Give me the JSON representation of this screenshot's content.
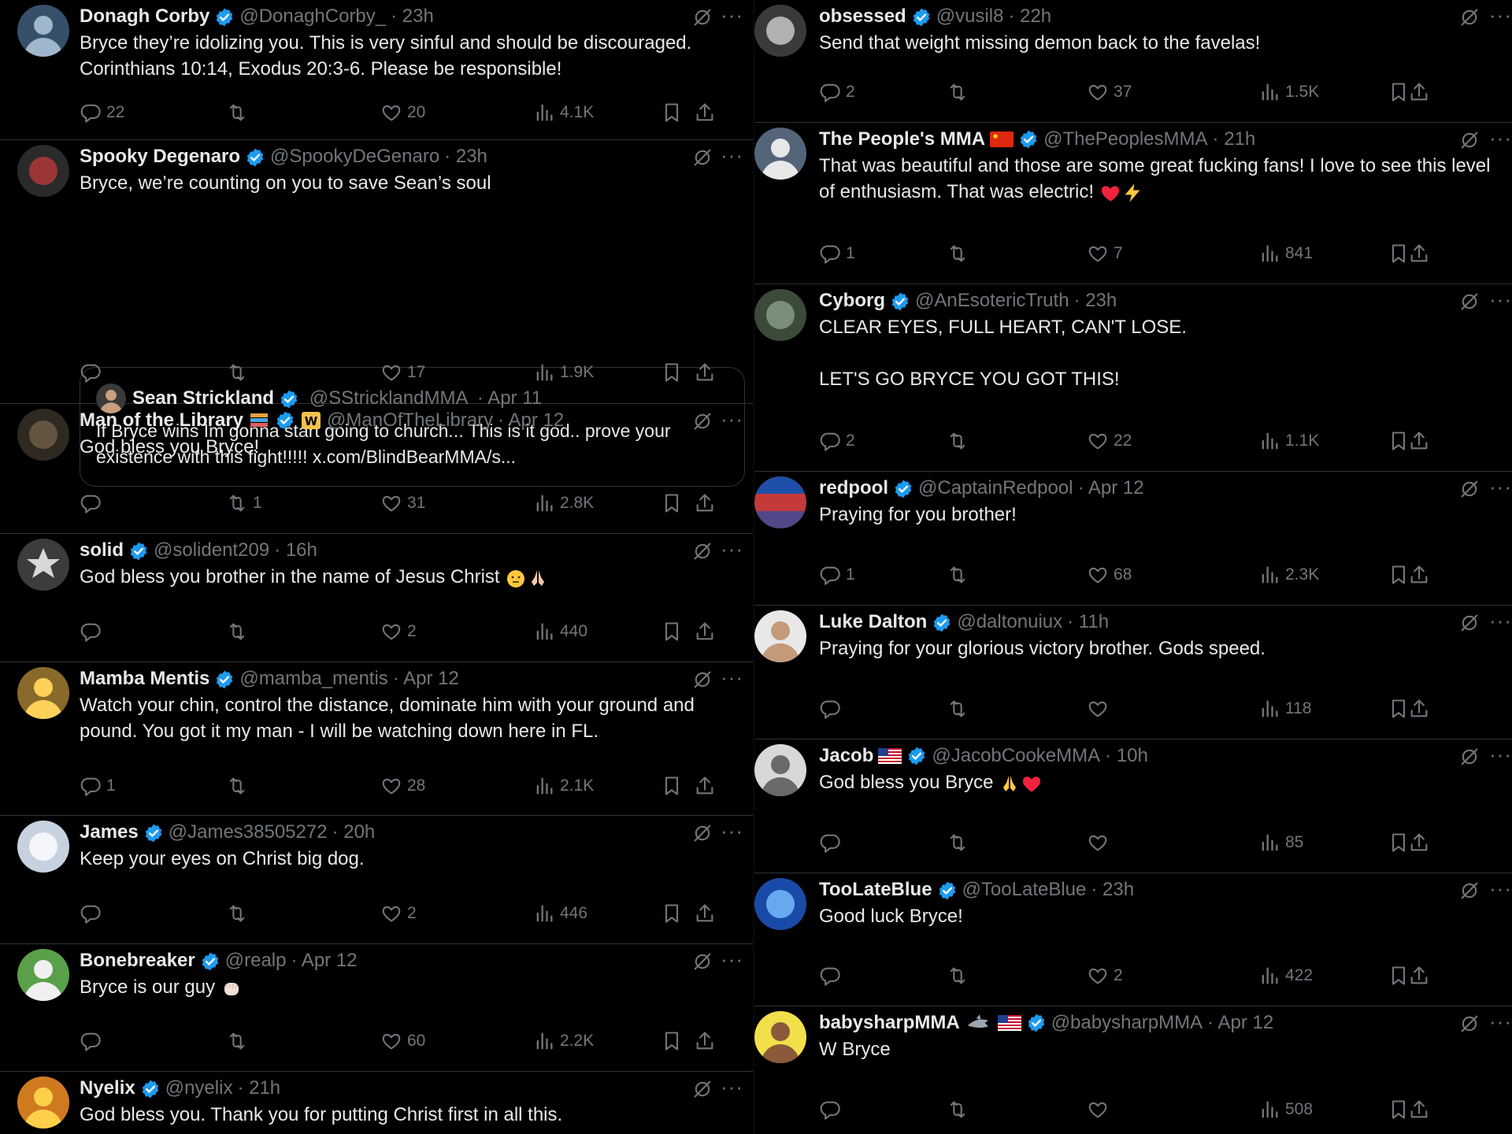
{
  "left_column": [
    {
      "name": "Donagh Corby",
      "handle": "@DonaghCorby_",
      "time": "· 23h",
      "text": "Bryce they’re idolizing you. This is very sinful and should be discouraged. Corinthians 10:14, Exodus 20:3-6. Please be responsible!",
      "replies": "22",
      "retweets": "",
      "likes": "20",
      "views": "4.1K"
    },
    {
      "name": "Spooky Degenaro",
      "handle": "@SpookyDeGenaro",
      "time": "· 23h",
      "text": "Bryce, we’re counting on you to save Sean’s soul",
      "replies": "",
      "retweets": "",
      "likes": "17",
      "views": "1.9K",
      "quote": {
        "name": "Sean Strickland",
        "handle": "@SStricklandMMA",
        "time": "· Apr 11",
        "text": "If Bryce wins Im gonna start going to church... This is it god.. prove your existence with this fight!!!!! x.com/BlindBearMMA/s..."
      }
    },
    {
      "name": "Man of the Library",
      "handle": "@ManOfTheLibrary",
      "time": "· Apr 12",
      "text": "God bless you Bryce!",
      "replies": "",
      "retweets": "1",
      "likes": "31",
      "views": "2.8K"
    },
    {
      "name": "solid",
      "handle": "@solident209",
      "time": "· 16h",
      "text": "God bless you brother in the name of Jesus Christ",
      "replies": "",
      "retweets": "",
      "likes": "2",
      "views": "440"
    },
    {
      "name": "Mamba Mentis",
      "handle": "@mamba_mentis",
      "time": "· Apr 12",
      "text": "Watch your chin, control the distance, dominate him with your ground and pound.  You got it my man - I will be watching down here in FL.",
      "replies": "1",
      "retweets": "",
      "likes": "28",
      "views": "2.1K"
    },
    {
      "name": "James",
      "handle": "@James38505272",
      "time": "· 20h",
      "text": "Keep your eyes on Christ big dog.",
      "replies": "",
      "retweets": "",
      "likes": "2",
      "views": "446"
    },
    {
      "name": "Bonebreaker",
      "handle": "@realp",
      "time": "· Apr 12",
      "text": "Bryce is our guy",
      "replies": "",
      "retweets": "",
      "likes": "60",
      "views": "2.2K"
    },
    {
      "name": "Nyelix",
      "handle": "@nyelix",
      "time": "· 21h",
      "text": "God bless you.  Thank you for putting Christ first in all this.",
      "replies": "",
      "retweets": "",
      "likes": "",
      "views": ""
    }
  ],
  "right_column": [
    {
      "name": "obsessed",
      "handle": "@vusil8",
      "time": "· 22h",
      "text": "Send that weight missing demon back to the favelas!",
      "replies": "2",
      "retweets": "",
      "likes": "37",
      "views": "1.5K"
    },
    {
      "name": "The People's MMA",
      "handle": "@ThePeoplesMMA",
      "time": "· 21h",
      "text": "That was beautiful and those are some great fucking fans! I love to see this level of enthusiasm. That was electric!",
      "replies": "1",
      "retweets": "",
      "likes": "7",
      "views": "841"
    },
    {
      "name": "Cyborg",
      "handle": "@AnEsotericTruth",
      "time": "· 23h",
      "text": "CLEAR EYES, FULL HEART, CAN'T LOSE.",
      "text2": "LET'S GO BRYCE YOU GOT THIS!",
      "replies": "2",
      "retweets": "",
      "likes": "22",
      "views": "1.1K"
    },
    {
      "name": "redpool",
      "handle": "@CaptainRedpool",
      "time": "· Apr 12",
      "text": "Praying for you brother!",
      "replies": "1",
      "retweets": "",
      "likes": "68",
      "views": "2.3K"
    },
    {
      "name": "Luke Dalton",
      "handle": "@daltonuiux",
      "time": "· 11h",
      "text": "Praying for your glorious victory brother. Gods speed.",
      "replies": "",
      "retweets": "",
      "likes": "",
      "views": "118"
    },
    {
      "name": "Jacob",
      "handle": "@JacobCookeMMA",
      "time": "· 10h",
      "text": "God bless you Bryce",
      "replies": "",
      "retweets": "",
      "likes": "",
      "views": "85"
    },
    {
      "name": "TooLateBlue",
      "handle": "@TooLateBlue",
      "time": "· 23h",
      "text": "Good luck Bryce!",
      "replies": "",
      "retweets": "",
      "likes": "2",
      "views": "422"
    },
    {
      "name": "babysharpMMA",
      "handle": "@babysharpMMA",
      "time": "· Apr 12",
      "text": "W Bryce",
      "replies": "",
      "retweets": "",
      "likes": "",
      "views": "508"
    }
  ],
  "icons": {
    "reply": "reply-icon",
    "retweet": "retweet-icon",
    "like": "heart-icon",
    "views": "views-icon",
    "bookmark": "bookmark-icon",
    "share": "share-icon",
    "grok": "grok-icon",
    "more": "more-icon",
    "verified": "verified-badge-icon"
  },
  "colors": {
    "background": "#000000",
    "text": "#e7e9ea",
    "muted": "#71767b",
    "verified": "#1d9bf0",
    "divider": "#2f3336"
  }
}
